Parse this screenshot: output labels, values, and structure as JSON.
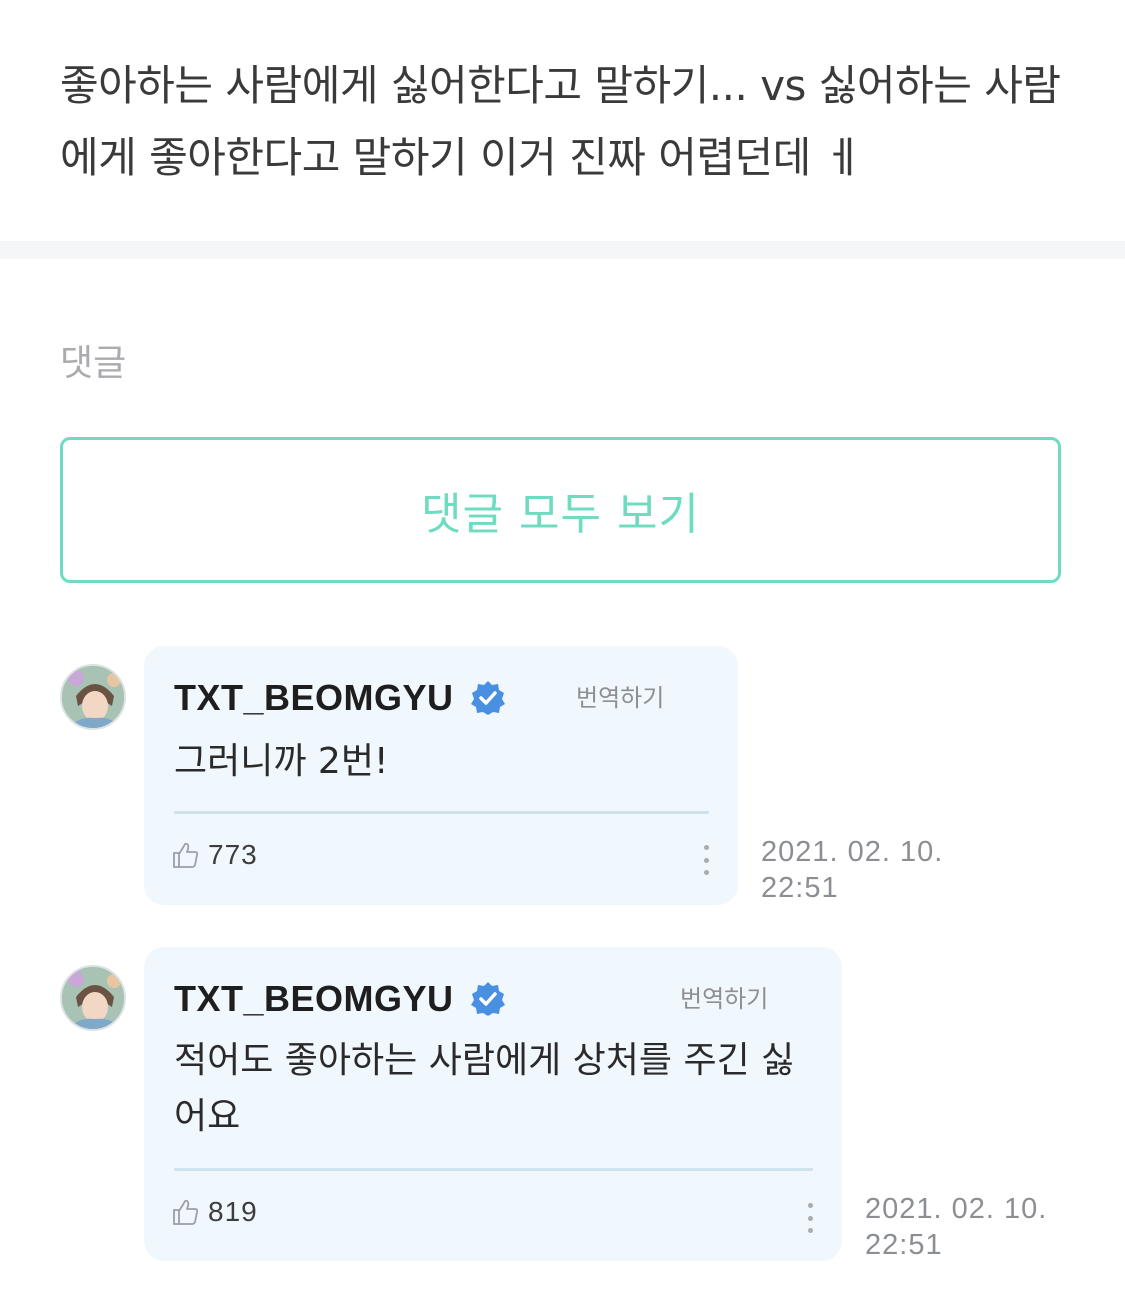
{
  "post": {
    "text": "좋아하는 사람에게 싫어한다고 말하기...  vs 싫어하는 사람에게 좋아한다고 말하기 이거 진짜 어렵던데 ㅔ"
  },
  "comments_section": {
    "label": "댓글",
    "view_all_label": "댓글 모두 보기"
  },
  "comments": [
    {
      "author": "TXT_BEOMGYU",
      "translate_label": "번역하기",
      "text": "그러니까 2번!",
      "likes": "773",
      "date": "2021. 02. 10.",
      "time": "22:51"
    },
    {
      "author": "TXT_BEOMGYU",
      "translate_label": "번역하기",
      "text": "적어도 좋아하는 사람에게 상처를 주긴 싫어요",
      "likes": "819",
      "date": "2021. 02. 10.",
      "time": "22:51"
    }
  ],
  "icons": {
    "verified": "verified-badge-icon",
    "like": "thumbs-up-icon",
    "more": "more-vertical-icon"
  },
  "colors": {
    "accent": "#6fdcc2",
    "bubble": "#f0f7fd",
    "verified": "#4a90e2",
    "muted": "#8d8f92"
  }
}
